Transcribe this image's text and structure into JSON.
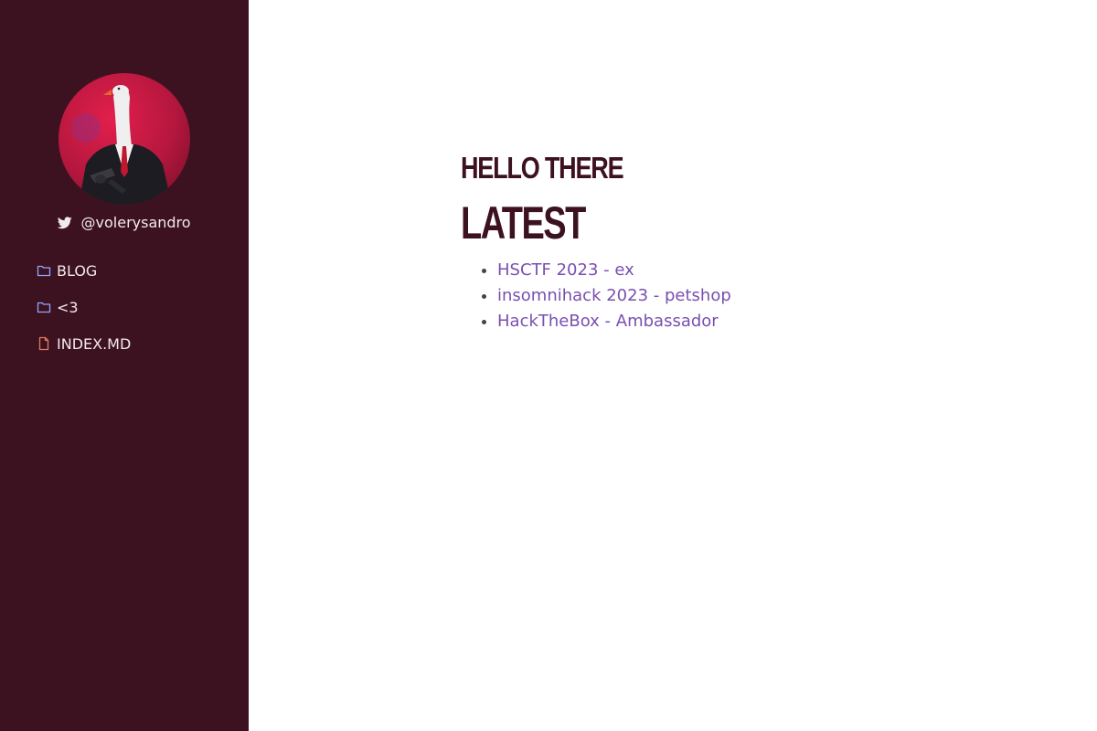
{
  "sidebar": {
    "background": "#3d1220",
    "avatar": {
      "alt": "goose in a suit avatar"
    },
    "handle": {
      "icon": "twitter-icon",
      "text": "@volerysandro"
    },
    "nav": [
      {
        "label": "BLOG",
        "icon": "folder-icon",
        "icon_color": "#8ea6ff"
      },
      {
        "label": "<3",
        "icon": "folder-icon",
        "icon_color": "#8ea6ff"
      },
      {
        "label": "INDEX.MD",
        "icon": "file-icon",
        "icon_color": "#e07a5f"
      }
    ]
  },
  "main": {
    "greeting": "HELLO THERE",
    "latest_heading": "LATEST",
    "posts": [
      {
        "title": "HSCTF 2023 - ex"
      },
      {
        "title": "insomnihack 2023 - petshop"
      },
      {
        "title": "HackTheBox - Ambassador"
      }
    ],
    "link_color": "#7a4fb0",
    "heading_color": "#3d1220"
  }
}
